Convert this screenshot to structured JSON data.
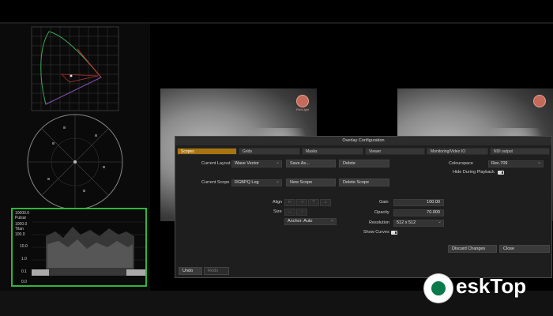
{
  "dialog": {
    "title": "Overlay Configuration",
    "tabs": [
      "Scopes",
      "Grids",
      "Masks",
      "Viewer",
      "Monitoring/Video IO",
      "NDI output"
    ],
    "active_tab": 0,
    "current_layout_label": "Current Layout",
    "current_layout_value": "Wave Vector",
    "save_as_label": "Save As...",
    "delete_label": "Delete",
    "current_scope_label": "Current Scope",
    "current_scope_value": "RGBPQ Log",
    "new_scope_label": "New Scope",
    "delete_scope_label": "Delete Scope",
    "colourspace_label": "Colourspace",
    "colourspace_value": "Rec.709",
    "hide_during_playback_label": "Hide During Playback",
    "align_label": "Align",
    "size_label": "Size",
    "anchor_value": "Anchor: Auto",
    "gain_label": "Gain",
    "gain_value": "100.00",
    "opacity_label": "Opacity",
    "opacity_value": "70.000",
    "resolution_label": "Resolution",
    "resolution_value": "512 x 512",
    "show_curves_label": "Show Curves",
    "undo_label": "Undo",
    "redo_label": "Redo",
    "discard_label": "Discard Changes",
    "close_label": "Close"
  },
  "waveform": {
    "labels": [
      "10000.0",
      "Pulsar",
      "1000.0",
      "Titan",
      "100.0",
      "10.0",
      "1.0",
      "0.1",
      "0.0"
    ]
  },
  "video_logo_text": "FilmLight",
  "watermark": {
    "text": "eskTop"
  }
}
